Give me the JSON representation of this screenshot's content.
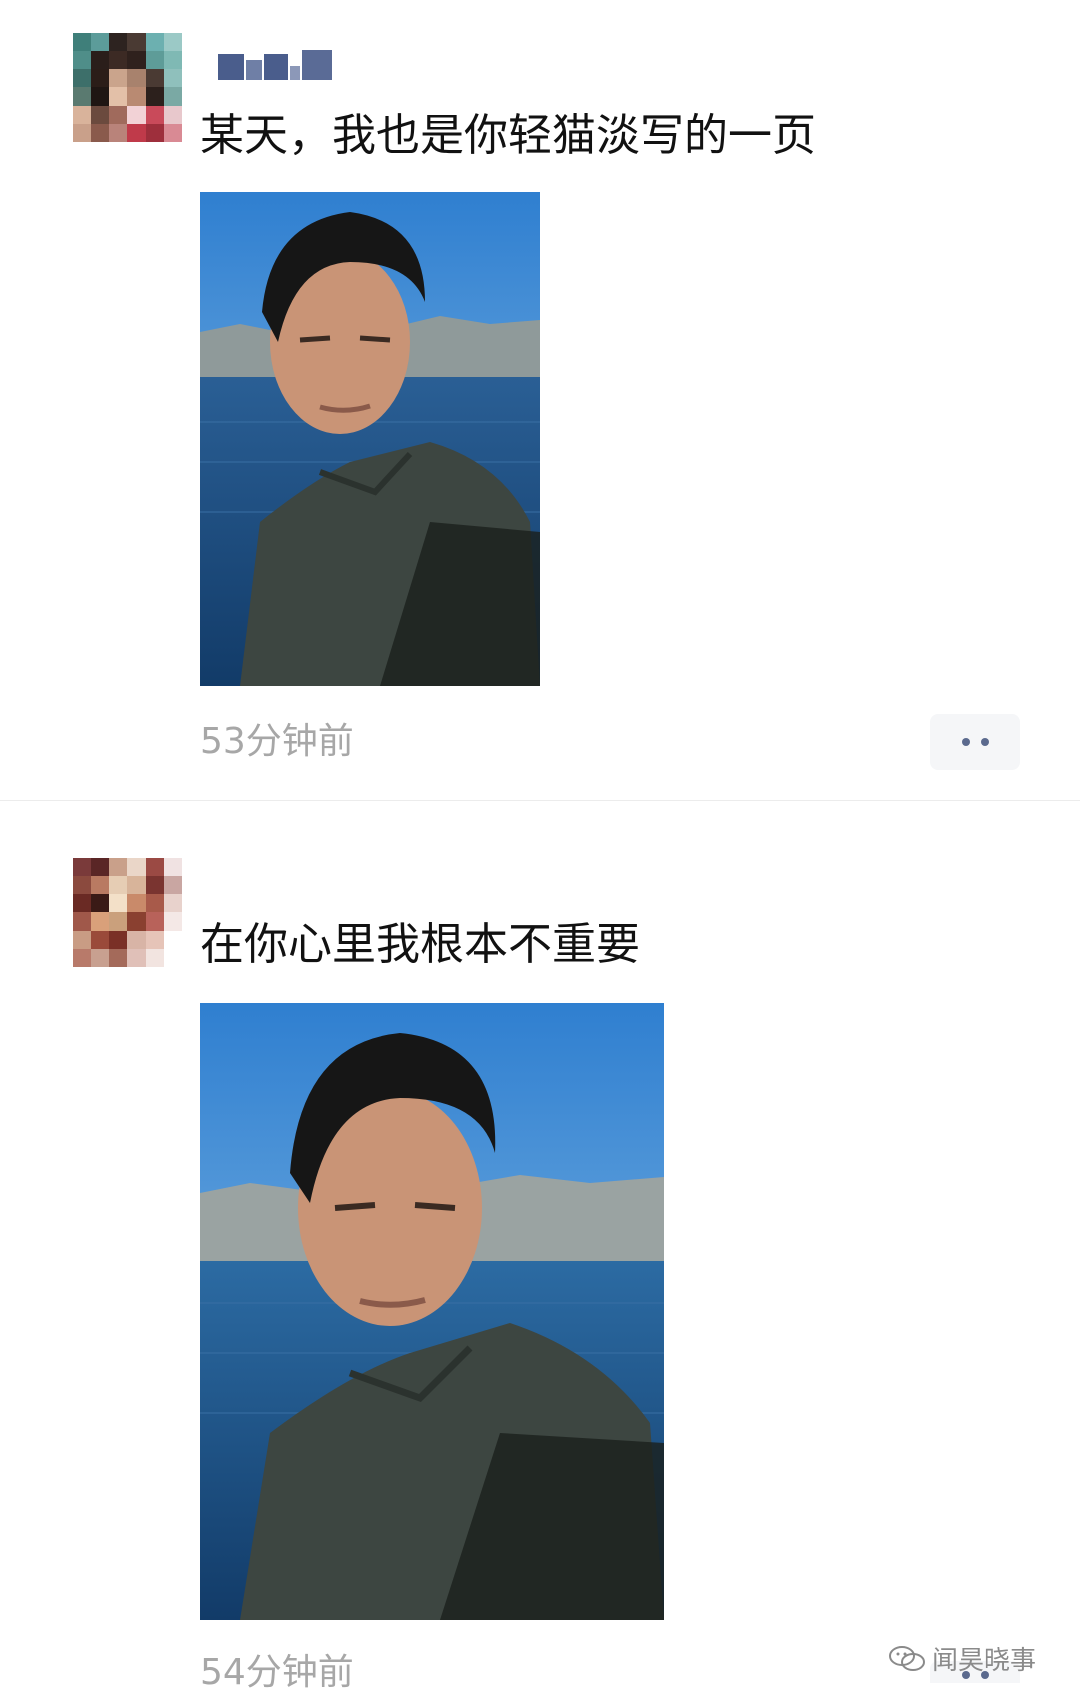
{
  "posts": [
    {
      "text": "某天，我也是你轻猫淡写的一页",
      "time": "53分钟前"
    },
    {
      "text": "在你心里我根本不重要",
      "time": "54分钟前"
    }
  ],
  "icons": {
    "more": "more-dots-icon",
    "watermark": "wechat-icon"
  },
  "watermark": {
    "text": "闻昊晓事"
  },
  "colors": {
    "link_blue": "#5b6a8e",
    "timestamp_gray": "#a7a7a7",
    "sky": "#3f8bd6",
    "water": "#1e4e82"
  }
}
